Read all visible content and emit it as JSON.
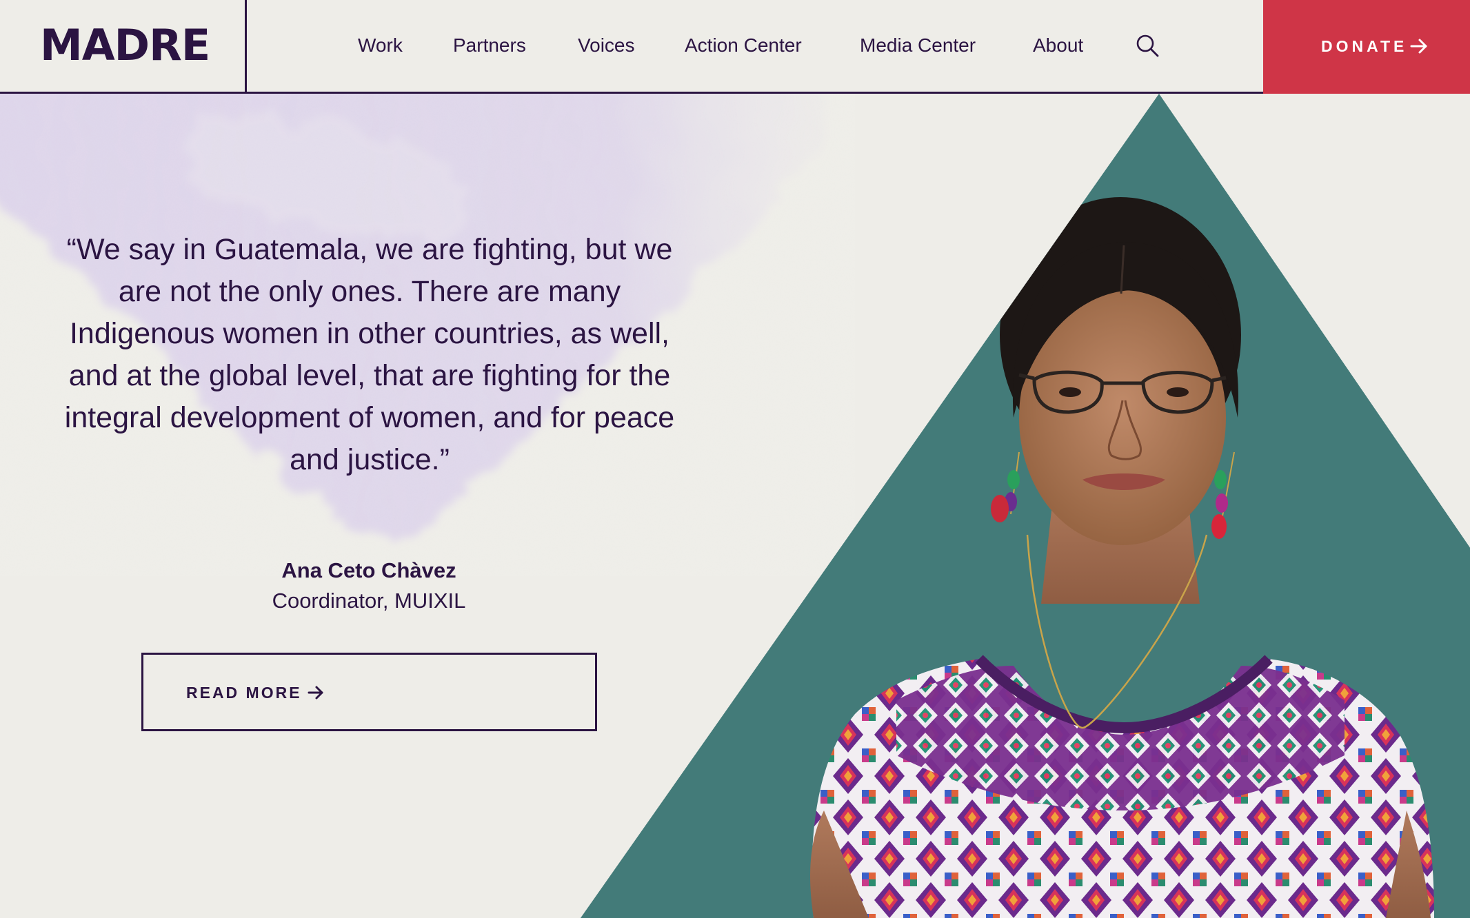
{
  "brand": {
    "logo_text": "MADRE"
  },
  "nav": {
    "items": [
      {
        "label": "Work"
      },
      {
        "label": "Partners"
      },
      {
        "label": "Voices"
      },
      {
        "label": "Action Center"
      },
      {
        "label": "Media Center"
      },
      {
        "label": "About"
      }
    ],
    "search_icon": "search-icon"
  },
  "donate": {
    "label": "DONATE",
    "icon": "arrow-right-icon"
  },
  "hero": {
    "quote": "“We say in Guatemala, we are fighting, but we are not the only ones. There are many Indigenous women in other countries, as well, and at the global level, that are fighting for the integral development of women, and for peace and justice.”",
    "attribution_name": "Ana Ceto Chàvez",
    "attribution_title": "Coordinator, MUIXIL",
    "cta_label": "READ MORE",
    "cta_icon": "arrow-right-icon"
  },
  "colors": {
    "background": "#eeede8",
    "ink": "#2b1442",
    "donate_red": "#cf3547",
    "triangle_teal": "#437b79",
    "watercolor_lavender": "#d9d0e6"
  }
}
